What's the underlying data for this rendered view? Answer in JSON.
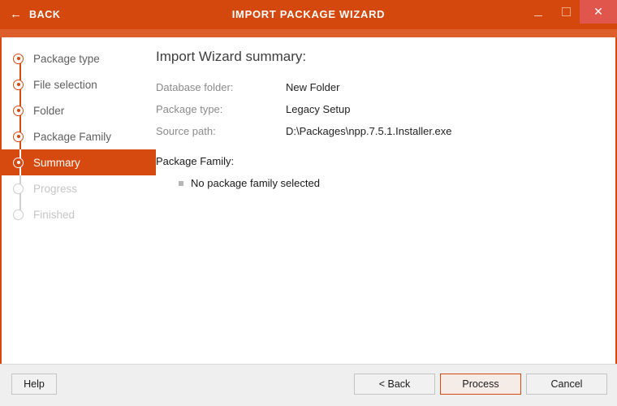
{
  "window": {
    "title": "IMPORT PACKAGE WIZARD",
    "back_label": "BACK",
    "back_icon": "arrow-left-icon",
    "minimize_icon": "minimize-icon",
    "maximize_icon": "maximize-icon",
    "close_icon": "close-icon",
    "close_glyph": "✕",
    "accent_color": "#d4480e",
    "accent_light_color": "#dd5f2b",
    "close_button_color": "#e0554c"
  },
  "sidebar": {
    "steps": [
      {
        "label": "Package type",
        "state": "done"
      },
      {
        "label": "File selection",
        "state": "done"
      },
      {
        "label": "Folder",
        "state": "done"
      },
      {
        "label": "Package Family",
        "state": "done"
      },
      {
        "label": "Summary",
        "state": "active"
      },
      {
        "label": "Progress",
        "state": "pending"
      },
      {
        "label": "Finished",
        "state": "pending"
      }
    ]
  },
  "content": {
    "title": "Import Wizard summary:",
    "rows": [
      {
        "label": "Database folder:",
        "value": "New Folder"
      },
      {
        "label": "Package type:",
        "value": "Legacy Setup"
      },
      {
        "label": "Source path:",
        "value": "D:\\Packages\\npp.7.5.1.Installer.exe"
      }
    ],
    "family_heading": "Package Family:",
    "family_items": [
      {
        "text": "No package family selected"
      }
    ]
  },
  "footer": {
    "help_label": "Help",
    "back_label": "< Back",
    "process_label": "Process",
    "cancel_label": "Cancel"
  }
}
